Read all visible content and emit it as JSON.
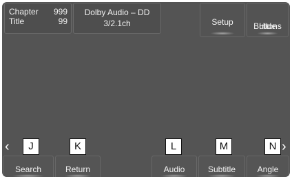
{
  "info": {
    "chapter_label": "Chapter",
    "chapter_value": "999",
    "title_label": "Title",
    "title_value": "99",
    "audio_format": "Dolby Audio – DD",
    "audio_channels": "3/2.1ch"
  },
  "top_buttons": {
    "setup": "Setup",
    "hide_line1": "Hide",
    "hide_line2": "Buttons"
  },
  "callouts": [
    "J",
    "K",
    "L",
    "M",
    "N"
  ],
  "arrows": {
    "left": "‹",
    "right": "›"
  },
  "bottom_buttons": {
    "search": "Search",
    "return": "Return",
    "audio": "Audio",
    "subtitle": "Subtitle",
    "angle": "Angle"
  },
  "colors": {
    "screen_bg": "#545454",
    "text": "#f2f2f2",
    "callout_bg": "#ffffff"
  }
}
